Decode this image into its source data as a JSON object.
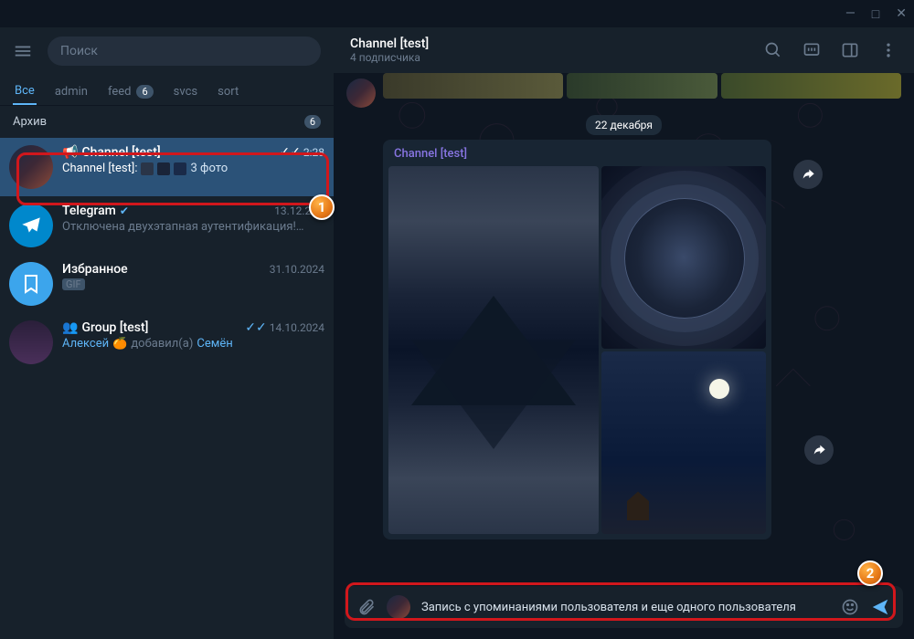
{
  "window": {
    "min": "—",
    "max": "□",
    "close": "✕"
  },
  "search": {
    "placeholder": "Поиск"
  },
  "folders": [
    {
      "label": "Все",
      "active": true
    },
    {
      "label": "admin"
    },
    {
      "label": "feed",
      "badge": "6"
    },
    {
      "label": "svcs"
    },
    {
      "label": "sort"
    }
  ],
  "archive": {
    "label": "Архив",
    "badge": "6"
  },
  "chats": [
    {
      "id": "channel",
      "name": "Channel [test]",
      "time": "2:28",
      "checks": "✓✓",
      "selected": true,
      "sender": "Channel [test]:",
      "suffix": "3 фото",
      "megaphone": true
    },
    {
      "id": "tg",
      "name": "Telegram",
      "verified": true,
      "time": "13.12.20…",
      "msg": "Отключена двухэтапная аутентификация!…"
    },
    {
      "id": "fav",
      "name": "Избранное",
      "time": "31.10.2024",
      "msg": "GIF",
      "gif": true
    },
    {
      "id": "grp",
      "name": "Group [test]",
      "time": "14.10.2024",
      "checks": "✓✓",
      "group": true,
      "actor": "Алексей",
      "emoji": "🍊",
      "action": "добавил(а)",
      "target": "Семён"
    }
  ],
  "header": {
    "title": "Channel [test]",
    "sub": "4 подписчика"
  },
  "date": "22 декабря",
  "bubble_name": "Channel [test]",
  "input": "Запись с упоминаниями пользователя и еще одного пользователя",
  "markers": {
    "1": "1",
    "2": "2"
  }
}
